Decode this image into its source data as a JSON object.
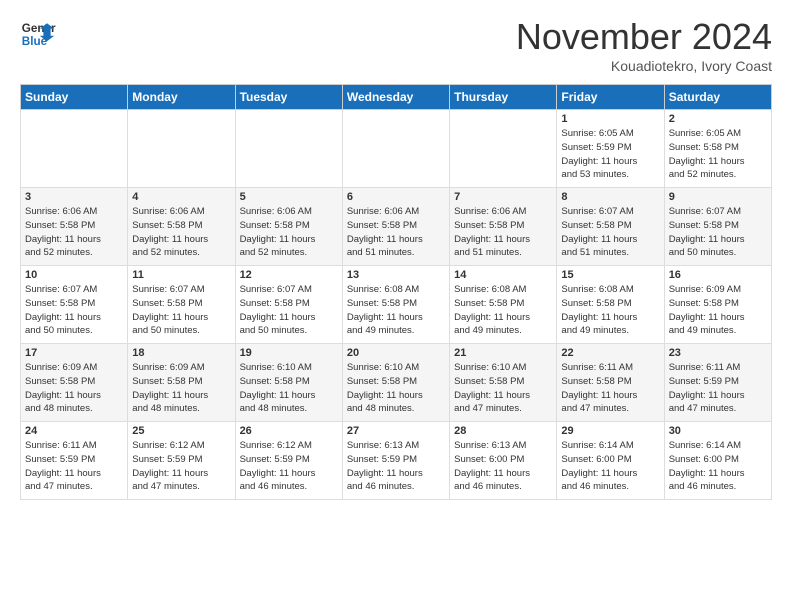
{
  "logo": {
    "text_general": "General",
    "text_blue": "Blue"
  },
  "header": {
    "month_title": "November 2024",
    "subtitle": "Kouadiotekro, Ivory Coast"
  },
  "weekdays": [
    "Sunday",
    "Monday",
    "Tuesday",
    "Wednesday",
    "Thursday",
    "Friday",
    "Saturday"
  ],
  "weeks": [
    [
      {
        "day": "",
        "info": ""
      },
      {
        "day": "",
        "info": ""
      },
      {
        "day": "",
        "info": ""
      },
      {
        "day": "",
        "info": ""
      },
      {
        "day": "",
        "info": ""
      },
      {
        "day": "1",
        "info": "Sunrise: 6:05 AM\nSunset: 5:59 PM\nDaylight: 11 hours\nand 53 minutes."
      },
      {
        "day": "2",
        "info": "Sunrise: 6:05 AM\nSunset: 5:58 PM\nDaylight: 11 hours\nand 52 minutes."
      }
    ],
    [
      {
        "day": "3",
        "info": "Sunrise: 6:06 AM\nSunset: 5:58 PM\nDaylight: 11 hours\nand 52 minutes."
      },
      {
        "day": "4",
        "info": "Sunrise: 6:06 AM\nSunset: 5:58 PM\nDaylight: 11 hours\nand 52 minutes."
      },
      {
        "day": "5",
        "info": "Sunrise: 6:06 AM\nSunset: 5:58 PM\nDaylight: 11 hours\nand 52 minutes."
      },
      {
        "day": "6",
        "info": "Sunrise: 6:06 AM\nSunset: 5:58 PM\nDaylight: 11 hours\nand 51 minutes."
      },
      {
        "day": "7",
        "info": "Sunrise: 6:06 AM\nSunset: 5:58 PM\nDaylight: 11 hours\nand 51 minutes."
      },
      {
        "day": "8",
        "info": "Sunrise: 6:07 AM\nSunset: 5:58 PM\nDaylight: 11 hours\nand 51 minutes."
      },
      {
        "day": "9",
        "info": "Sunrise: 6:07 AM\nSunset: 5:58 PM\nDaylight: 11 hours\nand 50 minutes."
      }
    ],
    [
      {
        "day": "10",
        "info": "Sunrise: 6:07 AM\nSunset: 5:58 PM\nDaylight: 11 hours\nand 50 minutes."
      },
      {
        "day": "11",
        "info": "Sunrise: 6:07 AM\nSunset: 5:58 PM\nDaylight: 11 hours\nand 50 minutes."
      },
      {
        "day": "12",
        "info": "Sunrise: 6:07 AM\nSunset: 5:58 PM\nDaylight: 11 hours\nand 50 minutes."
      },
      {
        "day": "13",
        "info": "Sunrise: 6:08 AM\nSunset: 5:58 PM\nDaylight: 11 hours\nand 49 minutes."
      },
      {
        "day": "14",
        "info": "Sunrise: 6:08 AM\nSunset: 5:58 PM\nDaylight: 11 hours\nand 49 minutes."
      },
      {
        "day": "15",
        "info": "Sunrise: 6:08 AM\nSunset: 5:58 PM\nDaylight: 11 hours\nand 49 minutes."
      },
      {
        "day": "16",
        "info": "Sunrise: 6:09 AM\nSunset: 5:58 PM\nDaylight: 11 hours\nand 49 minutes."
      }
    ],
    [
      {
        "day": "17",
        "info": "Sunrise: 6:09 AM\nSunset: 5:58 PM\nDaylight: 11 hours\nand 48 minutes."
      },
      {
        "day": "18",
        "info": "Sunrise: 6:09 AM\nSunset: 5:58 PM\nDaylight: 11 hours\nand 48 minutes."
      },
      {
        "day": "19",
        "info": "Sunrise: 6:10 AM\nSunset: 5:58 PM\nDaylight: 11 hours\nand 48 minutes."
      },
      {
        "day": "20",
        "info": "Sunrise: 6:10 AM\nSunset: 5:58 PM\nDaylight: 11 hours\nand 48 minutes."
      },
      {
        "day": "21",
        "info": "Sunrise: 6:10 AM\nSunset: 5:58 PM\nDaylight: 11 hours\nand 47 minutes."
      },
      {
        "day": "22",
        "info": "Sunrise: 6:11 AM\nSunset: 5:58 PM\nDaylight: 11 hours\nand 47 minutes."
      },
      {
        "day": "23",
        "info": "Sunrise: 6:11 AM\nSunset: 5:59 PM\nDaylight: 11 hours\nand 47 minutes."
      }
    ],
    [
      {
        "day": "24",
        "info": "Sunrise: 6:11 AM\nSunset: 5:59 PM\nDaylight: 11 hours\nand 47 minutes."
      },
      {
        "day": "25",
        "info": "Sunrise: 6:12 AM\nSunset: 5:59 PM\nDaylight: 11 hours\nand 47 minutes."
      },
      {
        "day": "26",
        "info": "Sunrise: 6:12 AM\nSunset: 5:59 PM\nDaylight: 11 hours\nand 46 minutes."
      },
      {
        "day": "27",
        "info": "Sunrise: 6:13 AM\nSunset: 5:59 PM\nDaylight: 11 hours\nand 46 minutes."
      },
      {
        "day": "28",
        "info": "Sunrise: 6:13 AM\nSunset: 6:00 PM\nDaylight: 11 hours\nand 46 minutes."
      },
      {
        "day": "29",
        "info": "Sunrise: 6:14 AM\nSunset: 6:00 PM\nDaylight: 11 hours\nand 46 minutes."
      },
      {
        "day": "30",
        "info": "Sunrise: 6:14 AM\nSunset: 6:00 PM\nDaylight: 11 hours\nand 46 minutes."
      }
    ]
  ]
}
